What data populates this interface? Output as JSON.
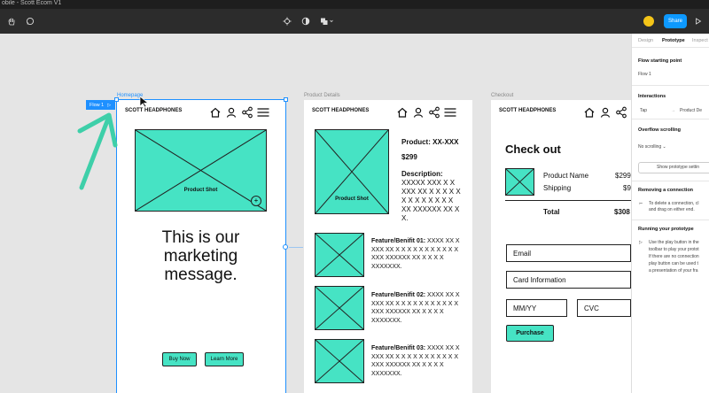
{
  "window": {
    "title": "obile - Scott Ecom V1"
  },
  "toolbar": {
    "share_label": "Share"
  },
  "canvas": {
    "flow_badge": "Flow 1",
    "frames": [
      {
        "label": "Homepage",
        "header": "SCOTT HEADPHONES",
        "product_shot": "Product Shot",
        "marketing": "This is our marketing message.",
        "buy_now": "Buy Now",
        "learn_more": "Learn More"
      },
      {
        "label": "Product Details",
        "header": "SCOTT HEADPHONES",
        "product_shot": "Product Shot",
        "product_line": "Product: XX-XXX",
        "price": "$299",
        "description_title": "Description:",
        "description_body": "XXXXX XXX X X XXX XX X X X X X X X X X X X X X XX XXXXXX XX X X.",
        "features": [
          {
            "title": "Feature/Benifit 01:",
            "body": "XXXX XX X XXX XX X X X X X X X X X X X XXX XXXXXX XX X X X X XXXXXXX."
          },
          {
            "title": "Feature/Benifit 02:",
            "body": "XXXX XX X XXX XX X X X X X X X X X X X XXX XXXXXX XX X X X X XXXXXXX."
          },
          {
            "title": "Feature/Benifit 03:",
            "body": "XXXX XX X XXX XX X X X X X X X X X X X XXX XXXXXX XX X X X X XXXXXXX."
          }
        ]
      },
      {
        "label": "Checkout",
        "header": "SCOTT HEADPHONES",
        "title": "Check out",
        "product_name": "Product Name",
        "product_price": "$299",
        "shipping": "Shipping",
        "shipping_price": "$9",
        "total": "Total",
        "total_price": "$308",
        "email": "Email",
        "card": "Card Information",
        "mmyy": "MM/YY",
        "cvc": "CVC",
        "purchase": "Purchase"
      }
    ]
  },
  "panel": {
    "tabs": [
      "Design",
      "Prototype",
      "Inspect"
    ],
    "flow_heading": "Flow starting point",
    "flow_value": "Flow 1",
    "interactions_heading": "Interactions",
    "trigger": "Tap",
    "target": "Product De",
    "overflow_heading": "Overflow scrolling",
    "overflow_value": "No scrolling",
    "show_settings": "Show prototype settin",
    "removing_heading": "Removing a connection",
    "removing_lines": [
      "To delete a connection, cl",
      "and drag on either end."
    ],
    "running_heading": "Running your prototype",
    "running_lines": [
      "Use the play button in the",
      "toolbar to play your protot",
      "If there are no connection",
      "play button can be used t",
      "a presentation of your fra"
    ]
  },
  "colors": {
    "accent": "#46e3c4",
    "share": "#0d99ff",
    "selection": "#1e90ff"
  }
}
